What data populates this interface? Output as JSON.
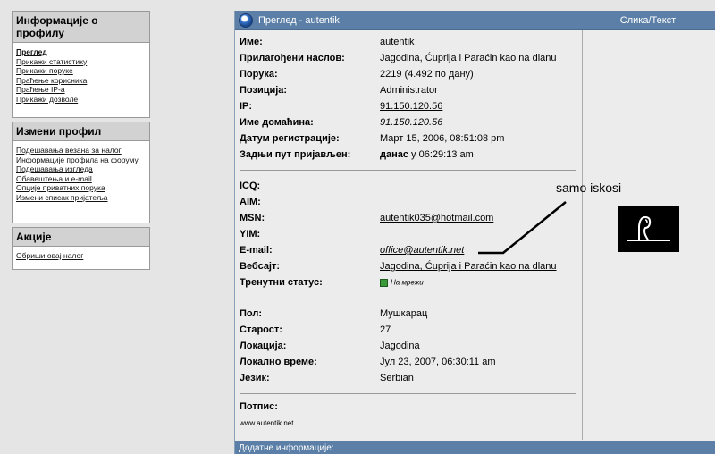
{
  "sidebar": {
    "info_box": {
      "title": "Информације о профилу",
      "items": [
        "Преглед",
        "Прикажи статистику",
        "Прикажи поруке",
        "Праћење корисника",
        "Праћење IP-а",
        "Прикажи дозволе"
      ]
    },
    "edit_box": {
      "title": "Измени профил",
      "items": [
        "Подешавања везана за налог",
        "Информације профила на форуму",
        "Подешавања изгледа",
        "Обавештења и e-mail",
        "Опције приватних порука",
        "Измени списак пријатеља"
      ]
    },
    "actions_box": {
      "title": "Акције",
      "items": [
        "Обриши овај налог"
      ]
    }
  },
  "panel": {
    "title": "Преглед - autentik",
    "right_title": "Слика/Текст"
  },
  "profile": {
    "name_label": "Име:",
    "name_value": "autentik",
    "custom_title_label": "Прилагођени наслов:",
    "custom_title_value": "Jagodina, Ćuprija i Paraćin kao na dlanu",
    "posts_label": "Порука:",
    "posts_value": "2219 (4.492 по дану)",
    "position_label": "Позиција:",
    "position_value": "Administrator",
    "ip_label": "IP:",
    "ip_value": "91.150.120.56",
    "host_label": "Име домаћина:",
    "host_value": "91.150.120.56",
    "reg_label": "Датум регистрације:",
    "reg_value": "Март 15, 2006, 08:51:08 pm",
    "last_label": "Задњи пут пријављен:",
    "last_value_bold": "данас",
    "last_value_rest": " у 06:29:13 am",
    "icq_label": "ICQ:",
    "aim_label": "AIM:",
    "msn_label": "MSN:",
    "msn_value": "autentik035@hotmail.com",
    "yim_label": "YIM:",
    "email_label": "E-mail:",
    "email_value": "office@autentik.net",
    "website_label": "Вебсајт:",
    "website_value": "Jagodina, Ćuprija i Paraćin kao na dlanu",
    "status_label": "Тренутни статус:",
    "status_value": "На мрежи",
    "gender_label": "Пол:",
    "gender_value": "Мушкарац",
    "age_label": "Старост:",
    "age_value": "27",
    "location_label": "Локација:",
    "location_value": "Jagodina",
    "local_time_label": "Локално време:",
    "local_time_value": "Јул 23, 2007, 06:30:11 am",
    "language_label": "Језик:",
    "language_value": "Serbian",
    "signature_label": "Потпис:",
    "signature_value": "www.autentik.net"
  },
  "annotation": {
    "text": "samo iskosi"
  },
  "footer": {
    "label": "Додатне информације:"
  },
  "colors": {
    "header_blue": "#5b7fa6",
    "sidebar_head": "#d2d2d2",
    "panel_bg": "#ececec"
  }
}
